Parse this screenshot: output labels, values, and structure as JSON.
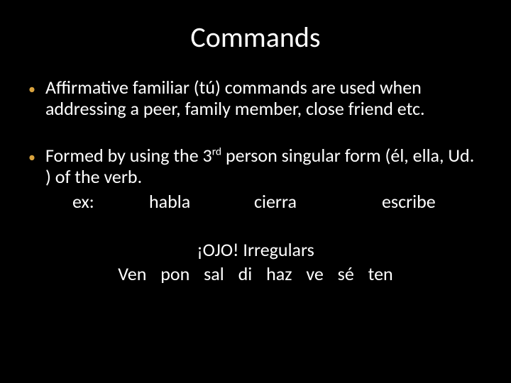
{
  "title": "Commands",
  "bullet1": "Affirmative familiar (tú) commands are used when addressing a peer, family member, close friend etc.",
  "bullet2_pre": "Formed by using the 3",
  "bullet2_sup": "rd",
  "bullet2_post": " person singular form (él, ella, Ud. ) of the verb.",
  "ex_label": "ex:",
  "ex_items": [
    "habla",
    "cierra",
    "escribe"
  ],
  "ojo_heading": "¡OJO!  Irregulars",
  "irregulars": "Ven  pon  sal  di  haz  ve  sé  ten"
}
